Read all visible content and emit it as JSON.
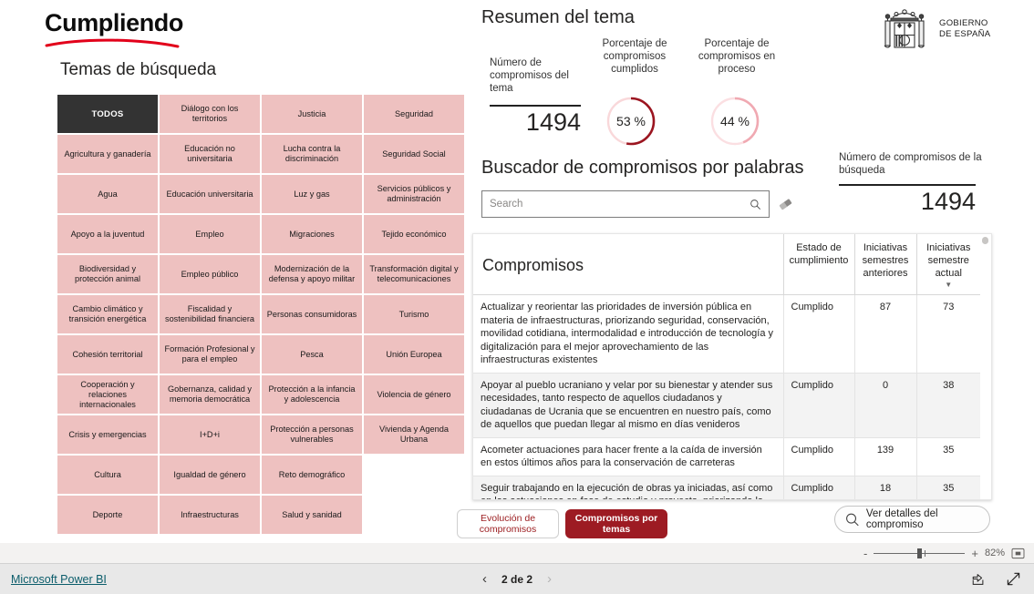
{
  "brand": {
    "name": "Cumpliendo"
  },
  "left": {
    "section_title": "Temas de búsqueda",
    "tiles": [
      "TODOS",
      "Diálogo con los territorios",
      "Justicia",
      "Seguridad",
      "Agricultura y ganadería",
      "Educación no universitaria",
      "Lucha contra la discriminación",
      "Seguridad Social",
      "Agua",
      "Educación universitaria",
      "Luz y gas",
      "Servicios públicos y administración",
      "Apoyo a la juventud",
      "Empleo",
      "Migraciones",
      "Tejido económico",
      "Biodiversidad y protección animal",
      "Empleo público",
      "Modernización de la defensa y apoyo militar",
      "Transformación digital y telecomunicaciones",
      "Cambio climático y transición energética",
      "Fiscalidad y sostenibilidad financiera",
      "Personas consumidoras",
      "Turismo",
      "Cohesión territorial",
      "Formación Profesional y para el empleo",
      "Pesca",
      "Unión Europea",
      "Cooperación y relaciones internacionales",
      "Gobernanza, calidad y memoria democrática",
      "Protección a la infancia y adolescencia",
      "Violencia de género",
      "Crisis y emergencias",
      "I+D+i",
      "Protección a personas vulnerables",
      "Vivienda y Agenda Urbana",
      "Cultura",
      "Igualdad de género",
      "Reto demográfico",
      "",
      "Deporte",
      "Infraestructuras",
      "Salud y sanidad",
      ""
    ],
    "selected_index": 0
  },
  "logo": {
    "line1": "GOBIERNO",
    "line2": "DE ESPAÑA",
    "alt": "Escudo de España"
  },
  "summary": {
    "title": "Resumen del tema",
    "kpi_total_label": "Número de compromisos del tema",
    "kpi_total_value": "1494",
    "gauge_cumplidos_label": "Porcentaje de compromisos cumplidos",
    "gauge_cumplidos_value": "53 %",
    "gauge_cumplidos_pct": 53,
    "gauge_proceso_label": "Porcentaje de compromisos en proceso",
    "gauge_proceso_value": "44 %",
    "gauge_proceso_pct": 44
  },
  "search": {
    "title": "Buscador de compromisos por palabras",
    "placeholder": "Search",
    "value": "",
    "results_label": "Número de compromisos de la búsqueda",
    "results_value": "1494"
  },
  "table": {
    "headers": [
      "Compromisos",
      "Estado de cumplimiento",
      "Iniciativas semestres anteriores",
      "Iniciativas semestre actual"
    ],
    "sorted_column_index": 3,
    "sort_direction": "desc",
    "rows": [
      {
        "compromiso": "Actualizar y reorientar las prioridades de inversión pública en materia de infraestructuras, priorizando seguridad, conservación, movilidad cotidiana, intermodalidad e introducción de tecnología y digitalización para el mejor aprovechamiento de las infraestructuras existentes",
        "estado": "Cumplido",
        "anteriores": "87",
        "actual": "73"
      },
      {
        "compromiso": "Apoyar al pueblo ucraniano y velar por su bienestar y atender sus necesidades, tanto respecto de aquellos ciudadanos y ciudadanas de Ucrania que se encuentren en nuestro país, como de aquellos que puedan llegar al mismo en días venideros",
        "estado": "Cumplido",
        "anteriores": "0",
        "actual": "38"
      },
      {
        "compromiso": "Acometer actuaciones para hacer frente a la caída de inversión en estos últimos años para la conservación de carreteras",
        "estado": "Cumplido",
        "anteriores": "139",
        "actual": "35"
      },
      {
        "compromiso": "Seguir trabajando en la ejecución de obras ya iniciadas, así como en las actuaciones en fase de estudio y proyecto, priorizando la atención a la conservación y el mantenimiento de la infraestructura,",
        "estado": "Cumplido",
        "anteriores": "18",
        "actual": "35"
      }
    ]
  },
  "tabs": {
    "evolucion": "Evolución de compromisos",
    "temas": "Compromisos por temas",
    "active": "temas"
  },
  "detail_button": {
    "label": "Ver detalles del compromiso",
    "icon": "search-icon"
  },
  "zoombar": {
    "minus": "-",
    "plus": "+",
    "level": "82%",
    "fit_icon": "fit-to-page-icon"
  },
  "statusbar": {
    "powerbi_link": "Microsoft Power BI",
    "page_indicator": "2 de 2",
    "prev_icon": "chevron-left-icon",
    "next_icon": "chevron-right-icon",
    "share_icon": "share-icon",
    "fullscreen_icon": "fullscreen-icon"
  },
  "colors": {
    "tile_pink": "#eec1c0",
    "tile_selected": "#333333",
    "accent_red": "#9d1b23",
    "brand_red": "#e2001a",
    "gauge_track": "#f6d3d6"
  }
}
